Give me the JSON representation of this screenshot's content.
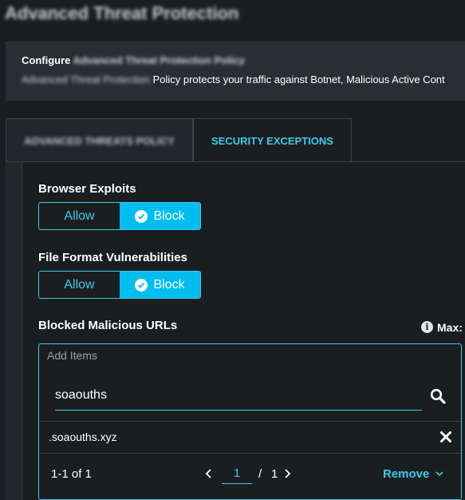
{
  "page": {
    "title": "Advanced Threat Protection"
  },
  "info": {
    "configure_prefix": "Configure",
    "configure_name": "Advanced Threat Protection Policy",
    "desc_prefix": "Advanced Threat Protection",
    "desc_text": "Policy protects your traffic against Botnet, Malicious Active Cont"
  },
  "tabs": [
    {
      "label": "ADVANCED THREATS POLICY",
      "active": false
    },
    {
      "label": "SECURITY EXCEPTIONS",
      "active": true
    }
  ],
  "sections": {
    "browser_exploits": {
      "label": "Browser Exploits",
      "allow": "Allow",
      "block": "Block",
      "selected": "Block"
    },
    "file_format": {
      "label": "File Format Vulnerabilities",
      "allow": "Allow",
      "block": "Block",
      "selected": "Block"
    },
    "blocked_urls": {
      "label": "Blocked Malicious URLs",
      "max_label": "Max:",
      "placeholder": "Add Items",
      "search_value": "soaouths",
      "items": [
        ".soaouths.xyz"
      ],
      "pager": {
        "count": "1-1 of 1",
        "page": "1",
        "separator": "/",
        "total": "1"
      },
      "remove_label": "Remove"
    }
  },
  "colors": {
    "accent": "#3ec9ec",
    "active_fill": "#00bdf0",
    "background": "#1b1e21"
  },
  "icons": [
    "check-circle-icon",
    "info-icon",
    "search-icon",
    "close-icon",
    "chevron-left-icon",
    "chevron-right-icon",
    "chevron-down-icon"
  ]
}
